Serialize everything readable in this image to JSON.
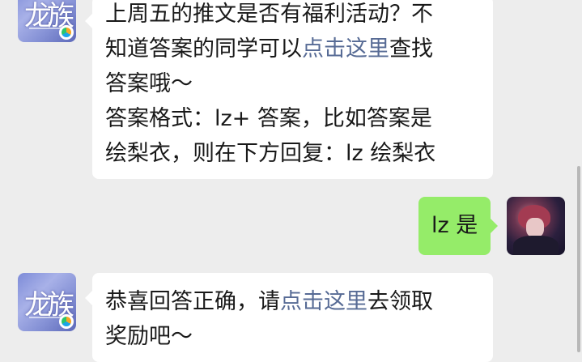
{
  "messages": [
    {
      "sender": "game-account",
      "avatar_icon": "game-logo-icon",
      "avatar_text": "龙族",
      "lines": [
        {
          "segments": [
            {
              "text": "上周五的推文是否有福利活动？不"
            }
          ]
        },
        {
          "segments": [
            {
              "text": "知道答案的同学可以"
            },
            {
              "text": "点击这里",
              "link": true
            },
            {
              "text": "查找"
            }
          ]
        },
        {
          "segments": [
            {
              "text": "答案哦～"
            }
          ]
        },
        {
          "segments": [
            {
              "text": "答案格式：lz+ 答案，比如答案是"
            }
          ]
        },
        {
          "segments": [
            {
              "text": "绘梨衣，则在下方回复：lz 绘梨衣"
            }
          ]
        }
      ]
    },
    {
      "sender": "me",
      "avatar_icon": "user-avatar-icon",
      "text": "lz 是"
    },
    {
      "sender": "game-account",
      "avatar_icon": "game-logo-icon",
      "avatar_text": "龙族",
      "lines": [
        {
          "segments": [
            {
              "text": "恭喜回答正确，请"
            },
            {
              "text": "点击这里",
              "link": true
            },
            {
              "text": "去领取"
            }
          ]
        },
        {
          "segments": [
            {
              "text": "奖励吧～"
            }
          ]
        }
      ]
    }
  ],
  "colors": {
    "background": "#ededed",
    "incoming_bubble": "#ffffff",
    "outgoing_bubble": "#95ec69",
    "link": "#576b95",
    "text": "#191919"
  }
}
